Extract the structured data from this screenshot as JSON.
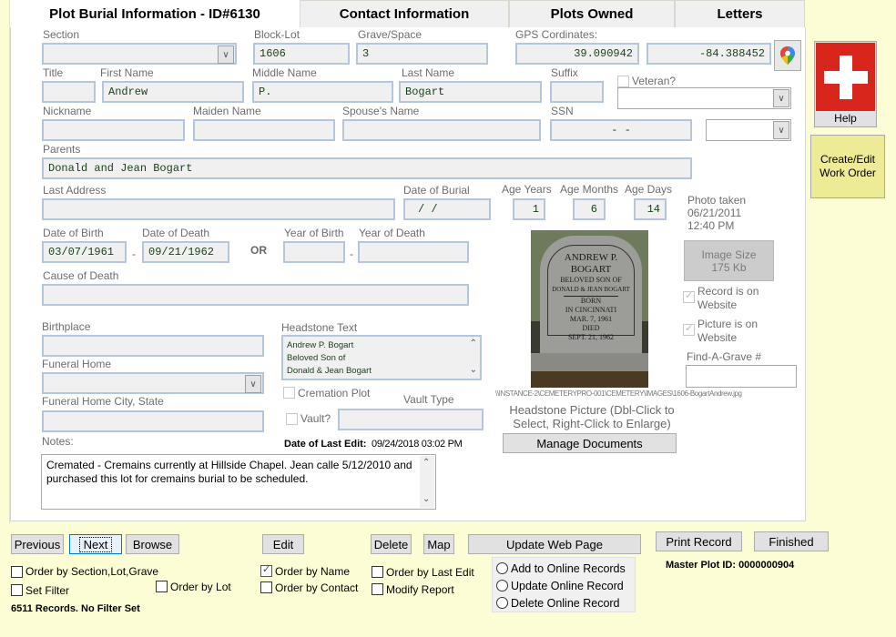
{
  "tabs": [
    {
      "label": "Plot Burial Information - ID#6130",
      "active": true
    },
    {
      "label": "Contact Information",
      "active": false
    },
    {
      "label": "Plots Owned",
      "active": false
    },
    {
      "label": "Letters",
      "active": false
    }
  ],
  "form": {
    "section": {
      "label": "Section",
      "value": ""
    },
    "block_lot": {
      "label": "Block-Lot",
      "value": "1606"
    },
    "grave_space": {
      "label": "Grave/Space",
      "value": "3"
    },
    "gps": {
      "label": "GPS Cordinates:",
      "lat": "39.090942",
      "lon": "-84.388452"
    },
    "title": {
      "label": "Title",
      "value": ""
    },
    "first_name": {
      "label": "First Name",
      "value": "Andrew"
    },
    "middle_name": {
      "label": "Middle Name",
      "value": "P."
    },
    "last_name": {
      "label": "Last Name",
      "value": "Bogart"
    },
    "suffix": {
      "label": "Suffix",
      "value": ""
    },
    "veteran": {
      "label": "Veteran?",
      "checked": false,
      "value": ""
    },
    "nickname": {
      "label": "Nickname",
      "value": ""
    },
    "maiden_name": {
      "label": "Maiden Name",
      "value": ""
    },
    "spouse_name": {
      "label": "Spouse's Name",
      "value": ""
    },
    "ssn": {
      "label": "SSN",
      "value": "-  -"
    },
    "ssn_type": {
      "value": ""
    },
    "parents": {
      "label": "Parents",
      "value": "Donald and Jean Bogart"
    },
    "last_address": {
      "label": "Last Address",
      "value": ""
    },
    "date_of_burial": {
      "label": "Date of Burial",
      "value": "/  /"
    },
    "age_years": {
      "label": "Age Years",
      "value": "1"
    },
    "age_months": {
      "label": "Age Months",
      "value": "6"
    },
    "age_days": {
      "label": "Age Days",
      "value": "14"
    },
    "date_of_birth": {
      "label": "Date of Birth",
      "value": "03/07/1961"
    },
    "date_of_death": {
      "label": "Date of Death",
      "value": "09/21/1962"
    },
    "dash": "-",
    "or_label": "OR",
    "year_of_birth": {
      "label": "Year of Birth",
      "value": ""
    },
    "year_of_death": {
      "label": "Year of Death",
      "value": ""
    },
    "cause_of_death": {
      "label": "Cause of Death",
      "value": ""
    },
    "birthplace": {
      "label": "Birthplace",
      "value": ""
    },
    "funeral_home": {
      "label": "Funeral Home",
      "value": ""
    },
    "funeral_home_city": {
      "label": "Funeral Home City, State",
      "value": ""
    },
    "headstone_text": {
      "label": "Headstone Text",
      "lines": [
        "Andrew P. Bogart",
        "Beloved Son of",
        "Donald & Jean Bogart"
      ]
    },
    "cremation_plot": {
      "label": "Cremation Plot",
      "checked": false
    },
    "vault": {
      "label": "Vault?",
      "checked": false
    },
    "vault_type": {
      "label": "Vault Type",
      "value": ""
    },
    "last_edit": {
      "label": "Date of Last Edit:",
      "value": "09/24/2018 03:02 PM"
    },
    "notes": {
      "label": "Notes:",
      "value": "Cremated - Cremains currently at Hillside Chapel.  Jean calle 5/12/2010 and purchased this lot for cremains burial to be scheduled."
    }
  },
  "photo": {
    "taken_label": "Photo taken",
    "taken_date": "06/21/2011",
    "taken_time": "12:40 PM",
    "image_size_label": "Image Size",
    "image_size_value": "175 Kb",
    "record_on_website": {
      "label": "Record is on Website",
      "checked": true
    },
    "picture_on_website": {
      "label": "Picture is on Website",
      "checked": true
    },
    "find_a_grave": {
      "label": "Find-A-Grave #",
      "value": ""
    },
    "path": "\\\\INSTANCE-2\\CEMETERYPRO-001\\CEMETERY\\IMAGES\\1606-BogartAndrew.jpg",
    "caption": "Headstone Picture (Dbl-Click to Select, Right-Click to Enlarge)",
    "stone_lines": [
      "ANDREW P. BOGART",
      "BELOVED SON OF",
      "DONALD & JEAN BOGART",
      "BORN",
      "IN CINCINNATI",
      "MAR. 7, 1961",
      "DIED",
      "SEPT. 21, 1962"
    ]
  },
  "side": {
    "help_label": "Help",
    "work_order_label": "Create/Edit Work Order"
  },
  "buttons": {
    "manage_documents": "Manage Documents",
    "previous": "Previous",
    "next": "Next",
    "browse": "Browse",
    "edit": "Edit",
    "delete": "Delete",
    "map": "Map",
    "update_web_page": "Update Web Page",
    "print_record": "Print Record",
    "finished": "Finished"
  },
  "options": {
    "order_section": {
      "label": "Order by Section,Lot,Grave",
      "checked": false
    },
    "set_filter": {
      "label": "Set Filter",
      "checked": false
    },
    "order_lot": {
      "label": "Order by Lot",
      "checked": false
    },
    "order_name": {
      "label": "Order by Name",
      "checked": true
    },
    "order_contact": {
      "label": "Order by Contact",
      "checked": false
    },
    "order_last_edit": {
      "label": "Order by Last Edit",
      "checked": false
    },
    "modify_report": {
      "label": "Modify Report",
      "checked": false
    }
  },
  "online": {
    "add": "Add to Online Records",
    "update": "Update Online Record",
    "delete": "Delete Online Record"
  },
  "status": {
    "records": "6511 Records. No Filter Set",
    "master_plot_id": "Master Plot ID: 0000000904"
  },
  "colors": {
    "background": "#fdfdd5",
    "help_red": "#d9261c",
    "work_order_bg": "#eeeb96",
    "field_text": "#173e17"
  }
}
